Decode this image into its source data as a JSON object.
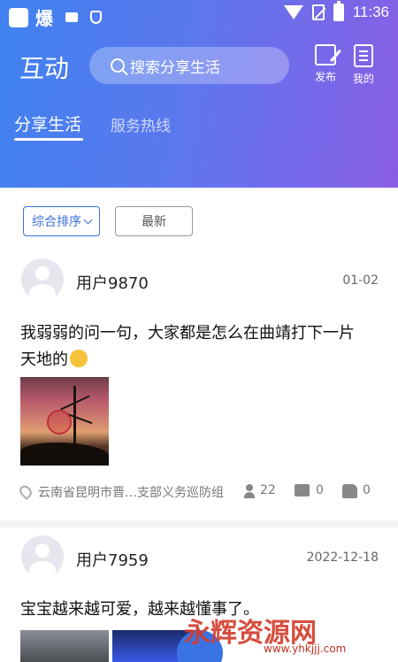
{
  "status_bar": {
    "app_label": "爆",
    "time": "11:36"
  },
  "header": {
    "title": "互动",
    "search_placeholder": "搜索分享生活",
    "publish_label": "发布",
    "mine_label": "我的"
  },
  "tabs": [
    {
      "label": "分享生活",
      "active": true
    },
    {
      "label": "服务热线",
      "active": false
    }
  ],
  "sort": {
    "combined_label": "综合排序",
    "latest_label": "最新"
  },
  "posts": [
    {
      "username": "用户9870",
      "date": "01-02",
      "text": "我弱弱的问一句，大家都是怎么在曲靖打下一片天地的",
      "emoji": "thinking-face",
      "location": "云南省昆明市晋…支部义务巡防组",
      "views": "22",
      "comments": "0",
      "likes": "0"
    },
    {
      "username": "用户7959",
      "date": "2022-12-18",
      "text": "宝宝越来越可爱，越来越懂事了。"
    }
  ],
  "watermark": {
    "text": "永辉资源网",
    "url": "www.yhkjjj.com"
  },
  "colors": {
    "header_gradient_start": "#3f82f0",
    "header_gradient_end": "#8a5ee6",
    "accent": "#3b6fd8",
    "watermark": "#d23a2a"
  }
}
